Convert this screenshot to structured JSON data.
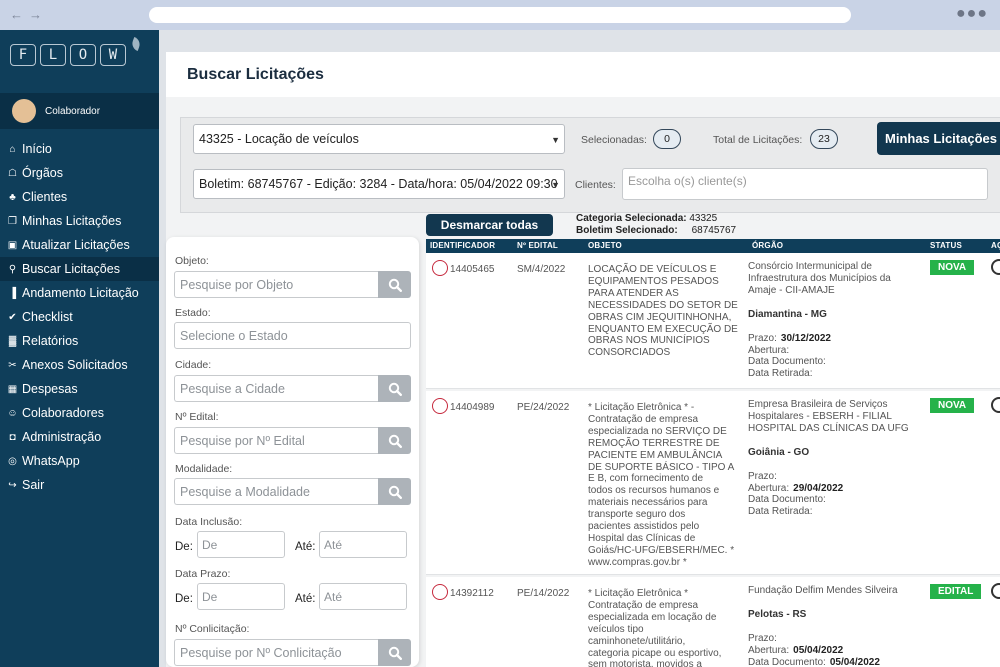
{
  "browser": {
    "nav_icons": "arrows-left-right",
    "menu_icon": "three-dots"
  },
  "sidebar": {
    "logo_letters": [
      "F",
      "L",
      "O",
      "W"
    ],
    "user_name": "Colaborador",
    "items": [
      {
        "label": "Início",
        "icon": "home-icon"
      },
      {
        "label": "Órgãos",
        "icon": "institution-icon"
      },
      {
        "label": "Clientes",
        "icon": "person-icon"
      },
      {
        "label": "Minhas Licitações",
        "icon": "copy-icon"
      },
      {
        "label": "Atualizar Licitações",
        "icon": "monitor-icon"
      },
      {
        "label": "Buscar Licitações",
        "icon": "search-icon"
      },
      {
        "label": "Andamento Licitação",
        "icon": "bar-chart-icon"
      },
      {
        "label": "Checklist",
        "icon": "check-icon"
      },
      {
        "label": "Relatórios",
        "icon": "chart-icon"
      },
      {
        "label": "Anexos Solicitados",
        "icon": "paperclip-icon"
      },
      {
        "label": "Despesas",
        "icon": "calculator-icon"
      },
      {
        "label": "Colaboradores",
        "icon": "users-icon"
      },
      {
        "label": "Administração",
        "icon": "lock-icon"
      },
      {
        "label": "WhatsApp",
        "icon": "whatsapp-icon"
      },
      {
        "label": "Sair",
        "icon": "logout-icon"
      }
    ],
    "active_index": 5
  },
  "page": {
    "title": "Buscar Licitações"
  },
  "top_filters": {
    "category_select": "43325 - Locação de veículos",
    "boletim_select": "Boletim: 68745767 - Edição: 3284 - Data/hora: 05/04/2022 09:30",
    "selecionadas_label": "Selecionadas:",
    "selecionadas_count": "0",
    "total_label": "Total de Licitações:",
    "total_count": "23",
    "minhas_button": "Minhas Licitações",
    "clientes_label": "Clientes:",
    "clientes_placeholder": "Escolha o(s) cliente(s)"
  },
  "left_filters": {
    "objeto_label": "Objeto:",
    "objeto_placeholder": "Pesquise por Objeto",
    "estado_label": "Estado:",
    "estado_placeholder": "Selecione o Estado",
    "cidade_label": "Cidade:",
    "cidade_placeholder": "Pesquise a Cidade",
    "edital_label": "Nº Edital:",
    "edital_placeholder": "Pesquise por Nº Edital",
    "modalidade_label": "Modalidade:",
    "modalidade_placeholder": "Pesquise a Modalidade",
    "inclusao_label": "Data Inclusão:",
    "prazo_label": "Data Prazo:",
    "de_label": "De:",
    "ate_label": "Até:",
    "de_placeholder": "De",
    "ate_placeholder": "Até",
    "conlicitacao_label": "Nº Conlicitação:",
    "conlicitacao_placeholder": "Pesquise por Nº Conlicitação"
  },
  "results": {
    "desmarcar_button": "Desmarcar todas",
    "categoria_label": "Categoria Selecionada:",
    "categoria_value": "43325",
    "boletim_label": "Boletim Selecionado:",
    "boletim_value": "68745767",
    "columns": [
      "IDENTIFICADOR",
      "Nº EDITAL",
      "OBJETO",
      "ÓRGÃO",
      "STATUS",
      "AÇ"
    ],
    "prazo_label": "Prazo:",
    "abertura_label": "Abertura:",
    "data_documento_label": "Data Documento:",
    "data_retirada_label": "Data Retirada:",
    "rows": [
      {
        "id": "14405465",
        "edital": "SM/4/2022",
        "objeto": [
          "LOCAÇÃO DE VEÍCULOS E",
          "EQUIPAMENTOS PESADOS",
          "PARA ATENDER AS",
          "NECESSIDADES DO SETOR DE",
          "OBRAS CIM JEQUITINHONHA,",
          "ENQUANTO EM EXECUÇÃO DE",
          "OBRAS NOS MUNICÍPIOS",
          "CONSORCIADOS"
        ],
        "orgao": [
          "Consórcio Intermunicipal de",
          "Infraestrutura dos Municípios da",
          "Amaje - CII-AMAJE"
        ],
        "cidade": "Diamantina - MG",
        "prazo": "30/12/2022",
        "abertura": "",
        "data_documento": "",
        "data_retirada": "",
        "status": "NOVA"
      },
      {
        "id": "14404989",
        "edital": "PE/24/2022",
        "objeto": [
          "* Licitação Eletrônica * -",
          "Contratação de empresa",
          "especializada no SERVIÇO DE",
          "REMOÇÃO TERRESTRE DE",
          "PACIENTE EM AMBULÂNCIA",
          "DE SUPORTE BÁSICO - TIPO A",
          "E B, com fornecimento de",
          "todos os recursos humanos e",
          "materiais necessários para",
          "transporte seguro dos",
          "pacientes assistidos pelo",
          "Hospital das Clínicas de",
          "Goiás/HC-UFG/EBSERH/MEC. *",
          "www.compras.gov.br *"
        ],
        "orgao": [
          "Empresa Brasileira de Serviços",
          "Hospitalares - EBSERH - FILIAL",
          "HOSPITAL DAS CLÍNICAS DA UFG"
        ],
        "cidade": "Goiânia - GO",
        "prazo": "",
        "abertura": "29/04/2022",
        "data_documento": "",
        "data_retirada": "",
        "status": "NOVA"
      },
      {
        "id": "14392112",
        "edital": "PE/14/2022",
        "objeto": [
          "* Licitação Eletrônica *",
          "Contratação de empresa",
          "especializada em locação de",
          "veículos tipo",
          "caminhonete/utilitário,",
          "categoria picape ou esportivo,",
          "sem motorista, movidos a"
        ],
        "orgao": [
          "Fundação Delfim Mendes Silveira"
        ],
        "cidade": "Pelotas - RS",
        "prazo": "",
        "abertura": "05/04/2022",
        "data_documento": "05/04/2022",
        "data_retirada": "",
        "status": "EDITAL"
      }
    ]
  },
  "colors": {
    "sidebar": "#0f3e5a",
    "status_green": "#25b24a",
    "check_red": "#c62a3e"
  }
}
